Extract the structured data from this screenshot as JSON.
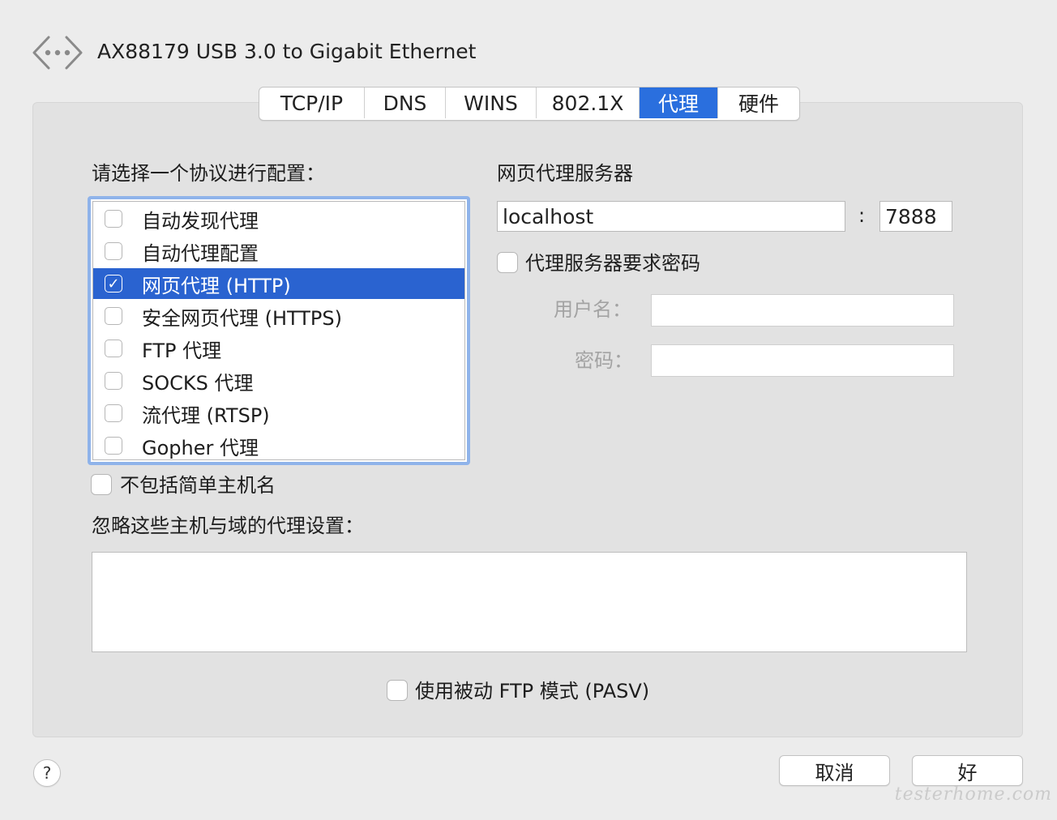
{
  "window": {
    "title": "AX88179 USB 3.0 to Gigabit Ethernet",
    "icon": "network-interface-icon"
  },
  "tabs": [
    {
      "label": "TCP/IP",
      "active": false
    },
    {
      "label": "DNS",
      "active": false
    },
    {
      "label": "WINS",
      "active": false
    },
    {
      "label": "802.1X",
      "active": false
    },
    {
      "label": "代理",
      "active": true
    },
    {
      "label": "硬件",
      "active": false
    }
  ],
  "protocols": {
    "heading": "请选择一个协议进行配置：",
    "items": [
      {
        "label": "自动发现代理",
        "checked": false,
        "selected": false
      },
      {
        "label": "自动代理配置",
        "checked": false,
        "selected": false
      },
      {
        "label": "网页代理 (HTTP)",
        "checked": true,
        "selected": true
      },
      {
        "label": "安全网页代理 (HTTPS)",
        "checked": false,
        "selected": false
      },
      {
        "label": "FTP 代理",
        "checked": false,
        "selected": false
      },
      {
        "label": "SOCKS 代理",
        "checked": false,
        "selected": false
      },
      {
        "label": "流代理 (RTSP)",
        "checked": false,
        "selected": false
      },
      {
        "label": "Gopher 代理",
        "checked": false,
        "selected": false
      }
    ]
  },
  "server": {
    "heading": "网页代理服务器",
    "host": "localhost",
    "separator": ":",
    "port": "7888",
    "auth_label": "代理服务器要求密码",
    "auth_checked": false,
    "username_label": "用户名：",
    "username": "",
    "password_label": "密码：",
    "password": ""
  },
  "exclude_simple": {
    "label": "不包括简单主机名",
    "checked": false
  },
  "bypass": {
    "label": "忽略这些主机与域的代理设置：",
    "value": ""
  },
  "pasv": {
    "label": "使用被动 FTP 模式 (PASV)",
    "checked": false
  },
  "buttons": {
    "help": "?",
    "cancel": "取消",
    "ok": "好"
  },
  "watermark": "testerhome.com",
  "colors": {
    "accent": "#2a6fde",
    "selection": "#2a63d0",
    "focus_ring": "#8fb3ea"
  }
}
